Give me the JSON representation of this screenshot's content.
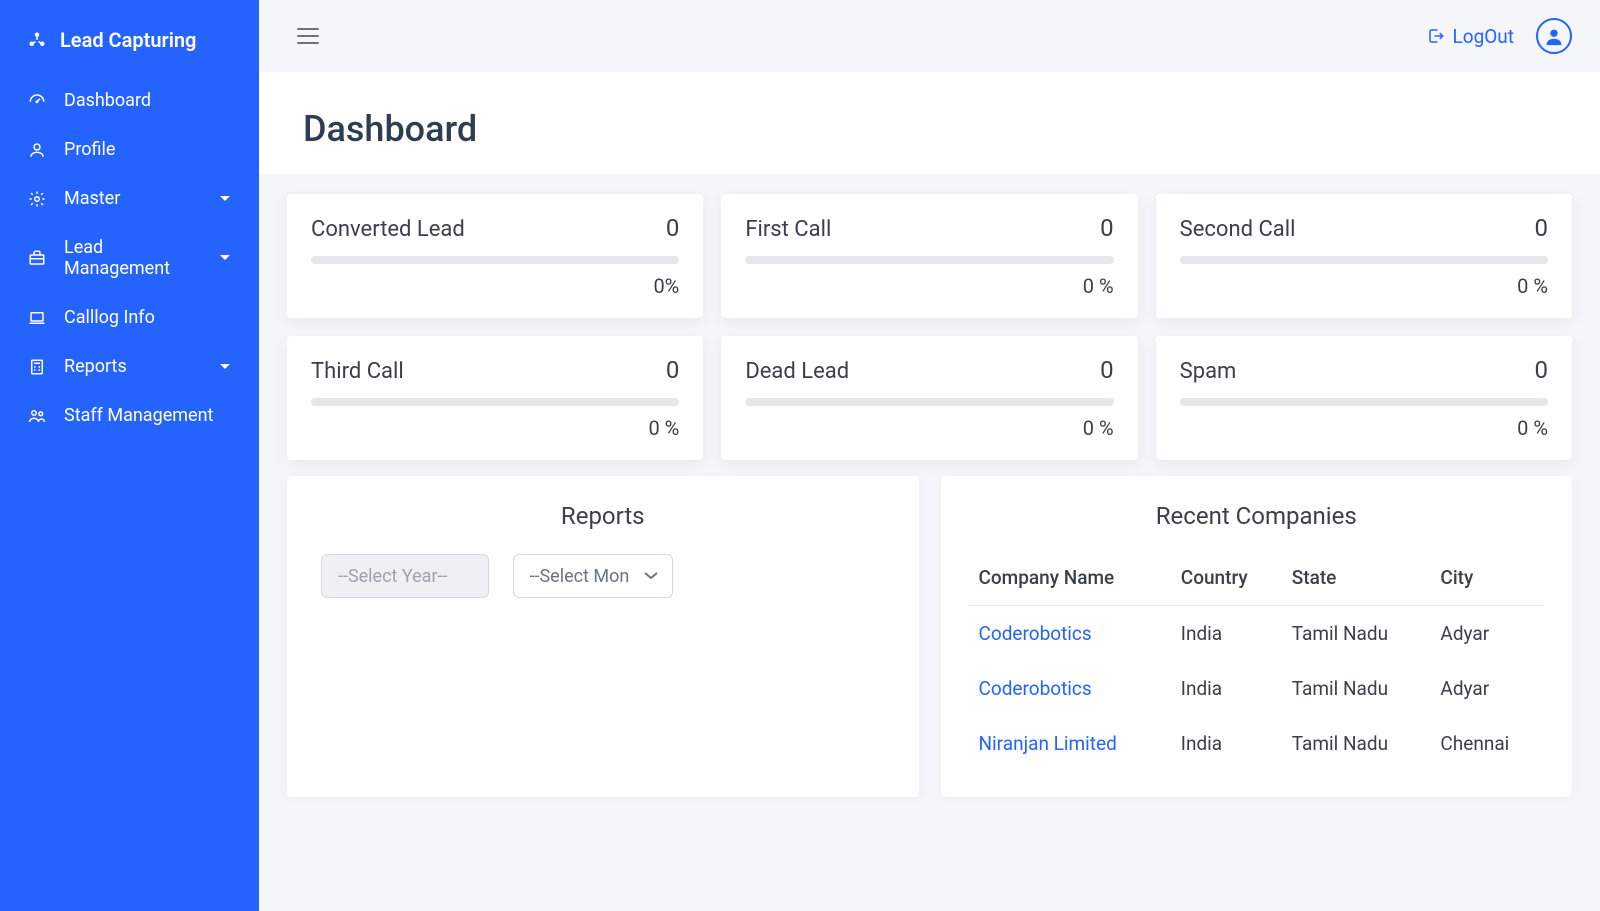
{
  "brand": "Lead Capturing",
  "sidebar": {
    "items": [
      {
        "label": "Dashboard",
        "hasCaret": false
      },
      {
        "label": "Profile",
        "hasCaret": false
      },
      {
        "label": "Master",
        "hasCaret": true
      },
      {
        "label": "Lead Management",
        "hasCaret": true
      },
      {
        "label": "Calllog Info",
        "hasCaret": false
      },
      {
        "label": "Reports",
        "hasCaret": true
      },
      {
        "label": "Staff Management",
        "hasCaret": false
      }
    ]
  },
  "header": {
    "logout_label": "LogOut"
  },
  "page_title": "Dashboard",
  "stats": [
    {
      "label": "Converted Lead",
      "value": "0",
      "pct": "0%"
    },
    {
      "label": "First Call",
      "value": "0",
      "pct": "0 %"
    },
    {
      "label": "Second Call",
      "value": "0",
      "pct": "0 %"
    },
    {
      "label": "Third Call",
      "value": "0",
      "pct": "0 %"
    },
    {
      "label": "Dead Lead",
      "value": "0",
      "pct": "0 %"
    },
    {
      "label": "Spam",
      "value": "0",
      "pct": "0 %"
    }
  ],
  "reports": {
    "title": "Reports",
    "year_placeholder": "--Select Year--",
    "month_placeholder": "--Select Mon"
  },
  "recent_companies": {
    "title": "Recent Companies",
    "columns": {
      "name": "Company Name",
      "country": "Country",
      "state": "State",
      "city": "City"
    },
    "rows": [
      {
        "name": "Coderobotics",
        "country": "India",
        "state": "Tamil Nadu",
        "city": "Adyar"
      },
      {
        "name": "Coderobotics",
        "country": "India",
        "state": "Tamil Nadu",
        "city": "Adyar"
      },
      {
        "name": "Niranjan Limited",
        "country": "India",
        "state": "Tamil Nadu",
        "city": "Chennai"
      }
    ]
  }
}
